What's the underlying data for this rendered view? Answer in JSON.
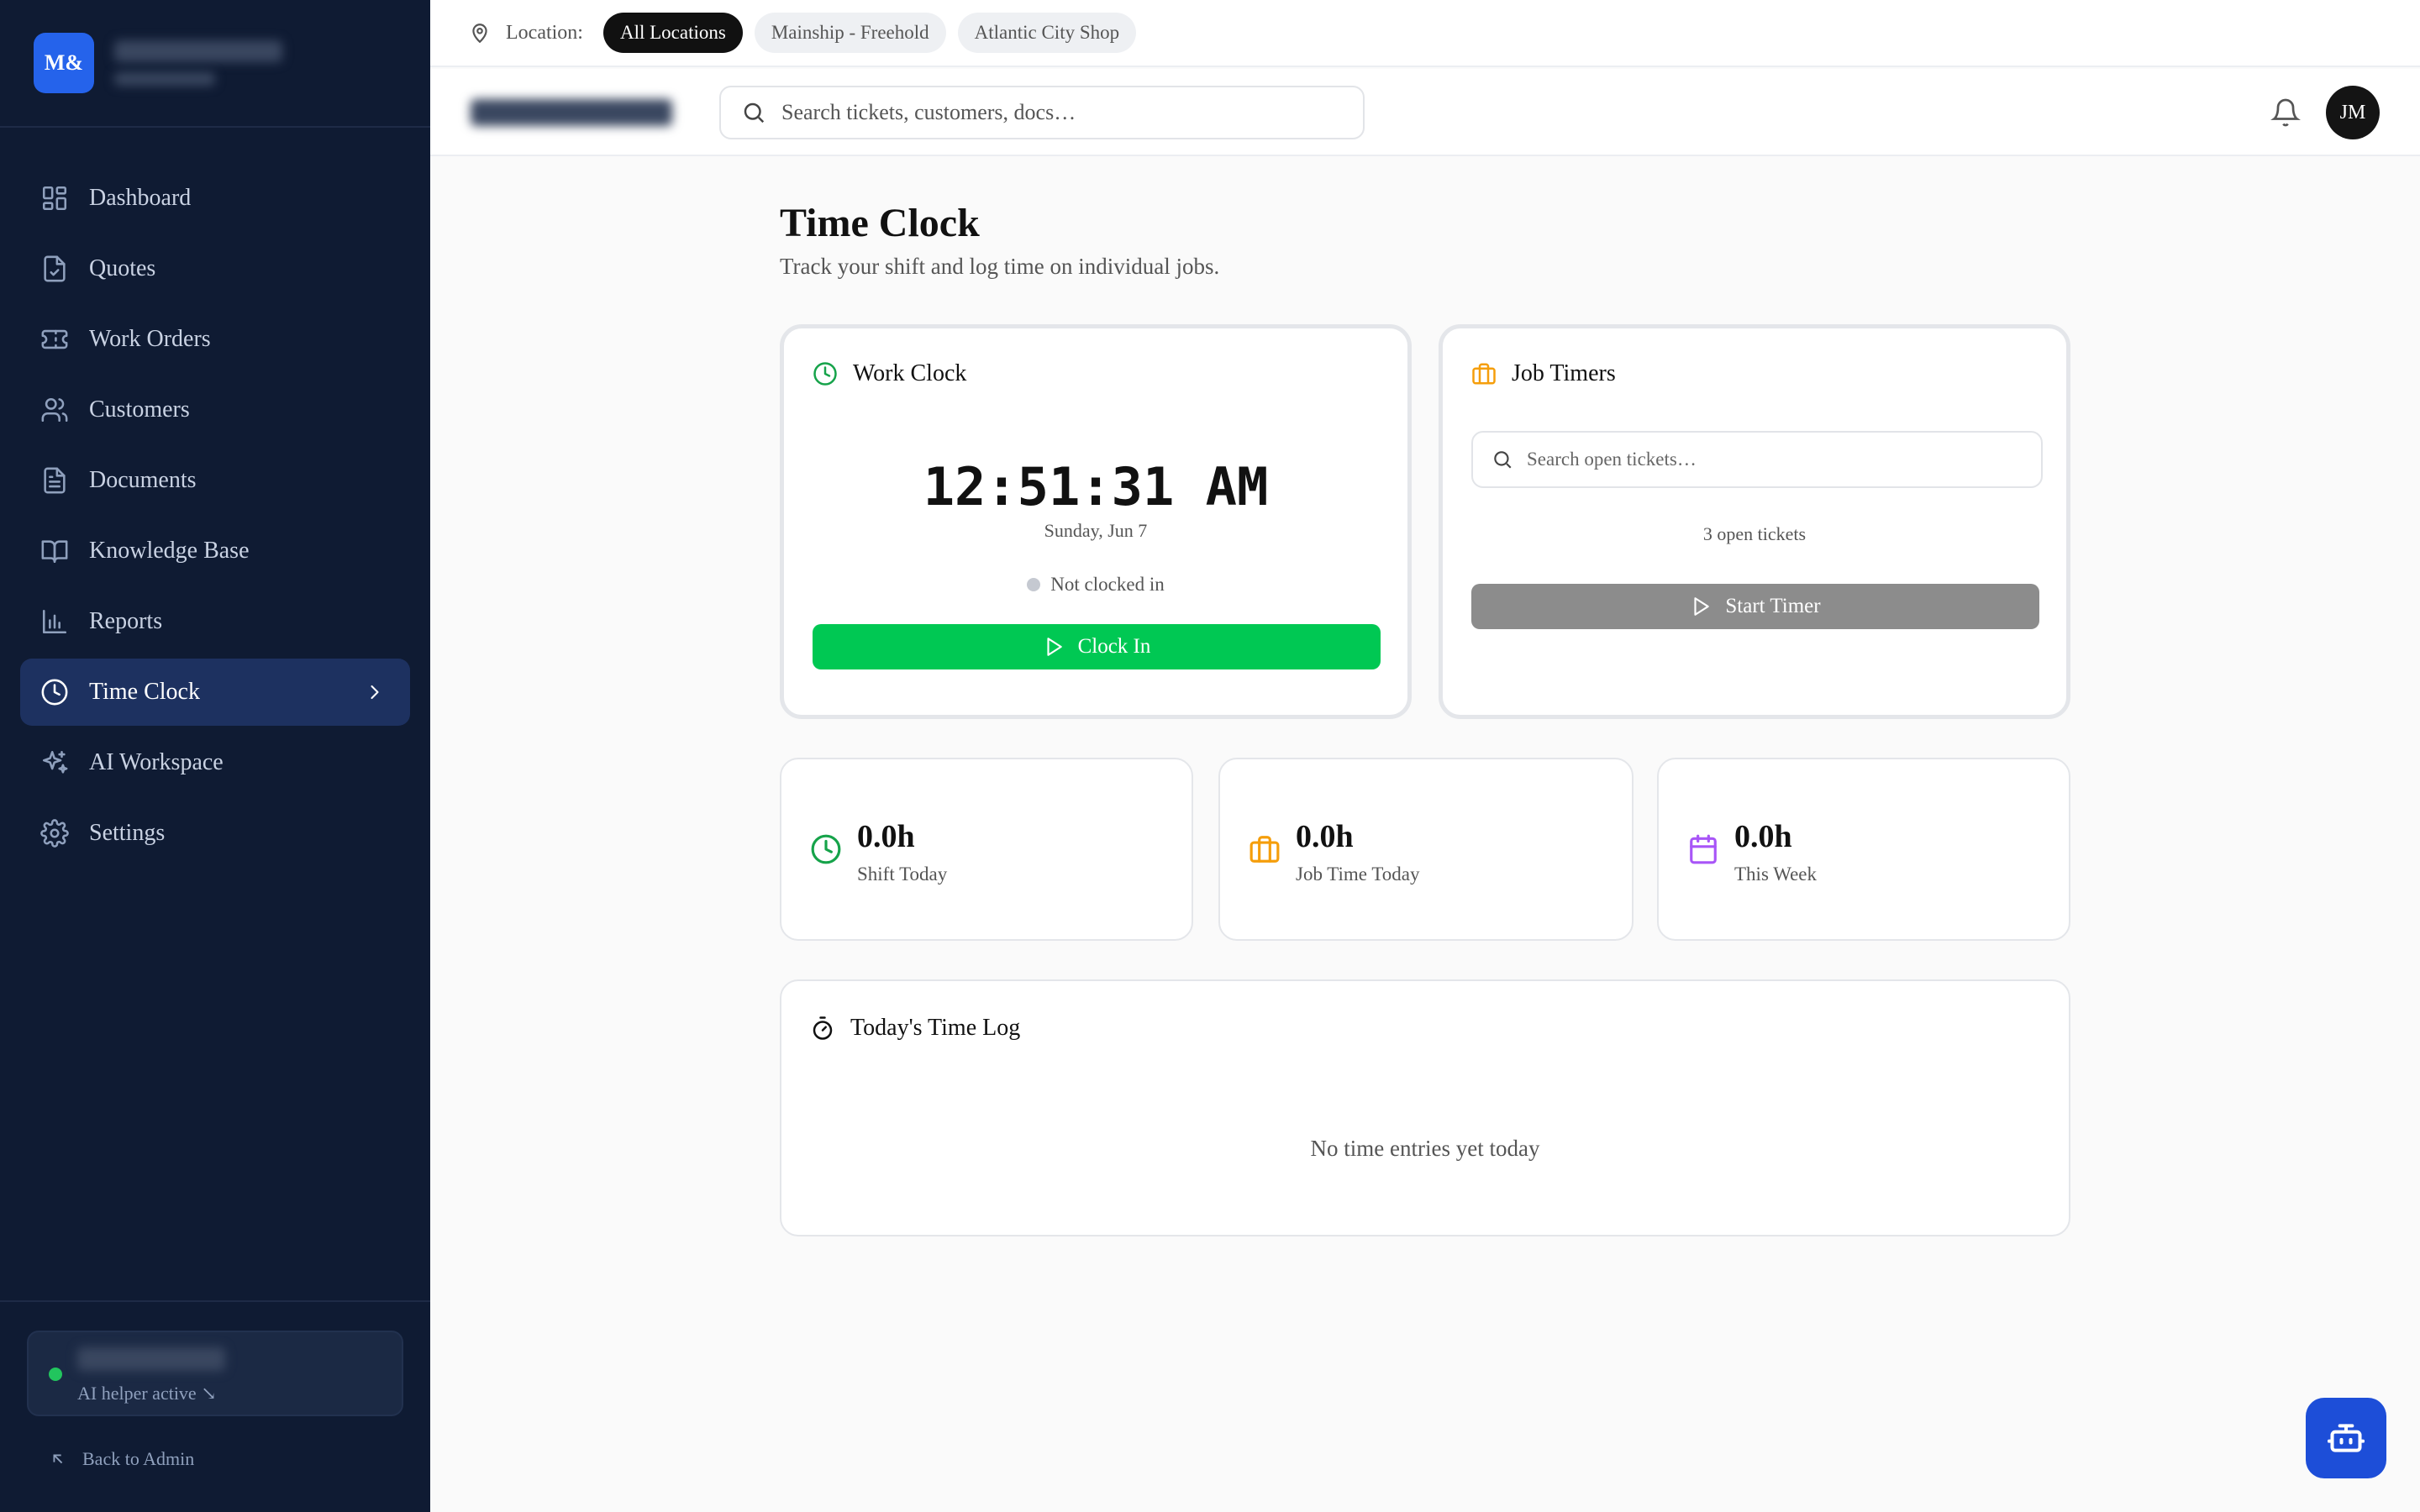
{
  "brand": {
    "logo_text": "M&"
  },
  "sidebar": {
    "items": [
      {
        "label": "Dashboard",
        "icon": "dashboard-icon"
      },
      {
        "label": "Quotes",
        "icon": "quote-icon"
      },
      {
        "label": "Work Orders",
        "icon": "ticket-icon"
      },
      {
        "label": "Customers",
        "icon": "users-icon"
      },
      {
        "label": "Documents",
        "icon": "document-icon"
      },
      {
        "label": "Knowledge Base",
        "icon": "book-icon"
      },
      {
        "label": "Reports",
        "icon": "bar-chart-icon"
      },
      {
        "label": "Time Clock",
        "icon": "clock-icon",
        "active": true
      },
      {
        "label": "AI Workspace",
        "icon": "sparkles-icon"
      },
      {
        "label": "Settings",
        "icon": "gear-icon"
      }
    ],
    "helper_status": "AI helper active ↘",
    "back_label": "Back to Admin"
  },
  "location": {
    "label": "Location:",
    "options": [
      "All Locations",
      "Mainship - Freehold",
      "Atlantic City Shop"
    ],
    "selected": "All Locations"
  },
  "header": {
    "search_placeholder": "Search tickets, customers, docs…",
    "avatar_initials": "JM"
  },
  "page": {
    "title": "Time Clock",
    "subtitle": "Track your shift and log time on individual jobs."
  },
  "work_clock": {
    "title": "Work Clock",
    "time": "12:51:31 AM",
    "date": "Sunday, Jun 7",
    "status": "Not clocked in",
    "button_label": "Clock In"
  },
  "job_timers": {
    "title": "Job Timers",
    "search_placeholder": "Search open tickets…",
    "open_count": "3 open tickets",
    "button_label": "Start Timer"
  },
  "stats": [
    {
      "value": "0.0h",
      "label": "Shift Today",
      "icon": "clock-icon",
      "color": "#16a34a"
    },
    {
      "value": "0.0h",
      "label": "Job Time Today",
      "icon": "briefcase-icon",
      "color": "#f59e0b"
    },
    {
      "value": "0.0h",
      "label": "This Week",
      "icon": "calendar-icon",
      "color": "#a855f7"
    }
  ],
  "time_log": {
    "title": "Today's Time Log",
    "empty": "No time entries yet today"
  },
  "colors": {
    "sidebar_bg": "#0f1b33",
    "active_nav": "#1d3160",
    "accent_blue": "#2563eb",
    "clock_in_green": "#00c853",
    "start_timer_gray": "#8c8c8c"
  }
}
